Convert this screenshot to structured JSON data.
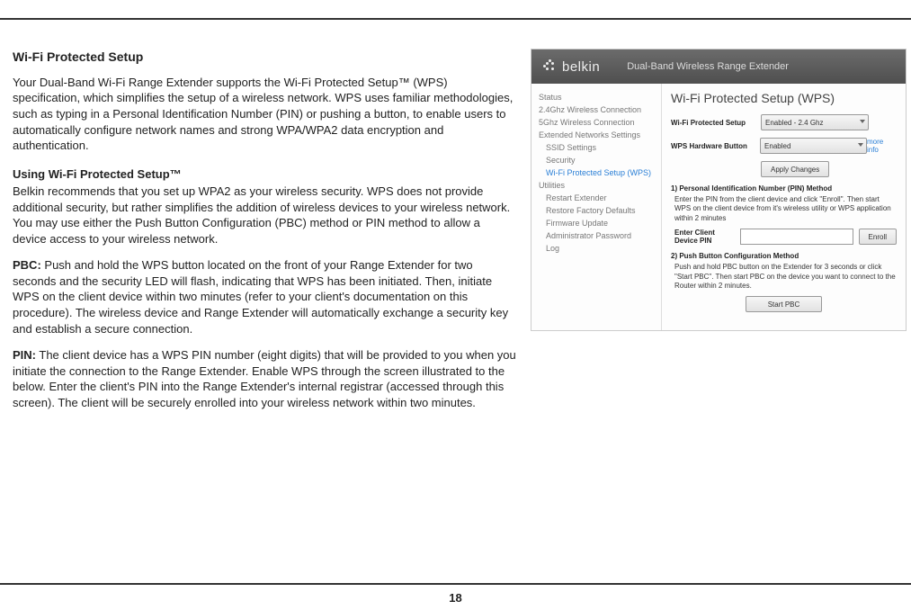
{
  "doc": {
    "h1": "Wi-Fi Protected Setup",
    "p1": "Your Dual-Band Wi-Fi Range Extender supports the Wi-Fi Protected Setup™ (WPS) specification, which simplifies the setup of a wireless network. WPS uses familiar methodologies, such as typing in a Personal Identification Number (PIN) or pushing a button, to enable users to automatically configure network names and strong WPA/WPA2 data encryption and authentication.",
    "h2a": "Using Wi-Fi Protected Setup™",
    "p2": "Belkin recommends that you set up WPA2 as your wireless security. WPS does not provide additional security, but rather simplifies the addition of wireless devices to your wireless network. You may use either the Push Button Configuration (PBC) method or PIN method to allow a device access to your wireless network.",
    "pbc_lbl": "PBC:",
    "pbc": " Push and hold the WPS button located on the front of your Range Extender for two seconds and the security LED will flash, indicating that WPS has been initiated. Then, initiate WPS on the client device within two minutes (refer to your client's documentation on this procedure). The wireless device and Range Extender will automatically exchange a security key and establish a secure connection.",
    "pin_lbl": "PIN:",
    "pin": " The client device has a WPS PIN number (eight digits) that will be provided to you when you initiate the connection to the Range Extender. Enable WPS through the screen illustrated to the below. Enter the client's PIN into the Range Extender's internal registrar (accessed through this screen). The client will be securely enrolled into your wireless network within two minutes.",
    "page_no": "18"
  },
  "ui": {
    "brand": "belkin",
    "header_title": "Dual-Band Wireless Range Extender",
    "sidebar": {
      "status": "Status",
      "g24": "2.4Ghz Wireless Connection",
      "g5": "5Ghz Wireless Connection",
      "ext": "Extended Networks Settings",
      "ssid": "SSID Settings",
      "sec": "Security",
      "wps": "Wi-Fi Protected Setup (WPS)",
      "util": "Utilities",
      "restart": "Restart Extender",
      "restore": "Restore Factory Defaults",
      "fw": "Firmware Update",
      "admin": "Administrator Password",
      "log": "Log"
    },
    "main": {
      "title": "Wi-Fi Protected Setup (WPS)",
      "row1_lbl": "Wi-Fi Protected Setup",
      "row1_val": "Enabled - 2.4 Ghz",
      "row2_lbl": "WPS Hardware Button",
      "row2_val": "Enabled",
      "more": "more info",
      "apply": "Apply Changes",
      "sec1_head": "1) Personal Identification Number (PIN) Method",
      "sec1_txt": "Enter the PIN from the client device and click \"Enroll\". Then start WPS on the client device from it's wireless utility or WPS application within 2 minutes",
      "pin_lbl": "Enter Client Device PIN",
      "enroll": "Enroll",
      "sec2_head": "2) Push Button Configuration Method",
      "sec2_txt": "Push and hold PBC button on the Extender for 3 seconds or click \"Start PBC\". Then start PBC on the device you want to connect to the Router within 2 minutes.",
      "startpbc": "Start PBC"
    }
  }
}
